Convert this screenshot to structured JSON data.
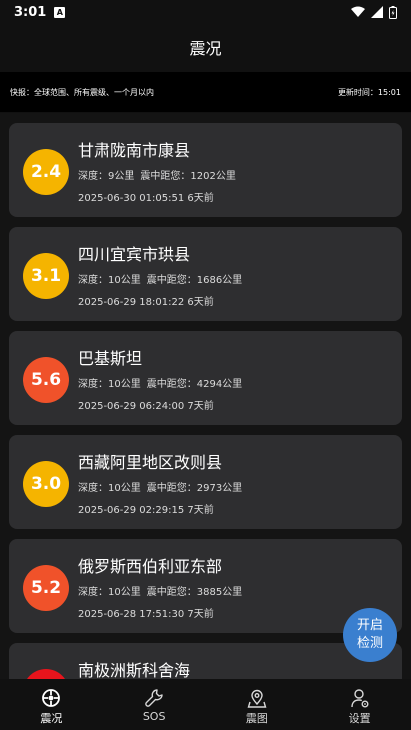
{
  "status_bar": {
    "time": "3:01",
    "notification_glyph": "A"
  },
  "header": {
    "title": "震况"
  },
  "info": {
    "left": "快报：全球范围、所有震级、一个月以内",
    "right": "更新时间：15:01"
  },
  "labels": {
    "depth_prefix": "深度：",
    "distance_prefix": "震中距您："
  },
  "earthquakes": [
    {
      "magnitude": "2.4",
      "color": "#f5b400",
      "place": "甘肃陇南市康县",
      "depth": "9公里",
      "distance": "1202公里",
      "time": "2025-06-30 01:05:51 6天前"
    },
    {
      "magnitude": "3.1",
      "color": "#f5b400",
      "place": "四川宜宾市珙县",
      "depth": "10公里",
      "distance": "1686公里",
      "time": "2025-06-29 18:01:22 6天前"
    },
    {
      "magnitude": "5.6",
      "color": "#f0522a",
      "place": "巴基斯坦",
      "depth": "10公里",
      "distance": "4294公里",
      "time": "2025-06-29 06:24:00 7天前"
    },
    {
      "magnitude": "3.0",
      "color": "#f5b400",
      "place": "西藏阿里地区改则县",
      "depth": "10公里",
      "distance": "2973公里",
      "time": "2025-06-29 02:29:15 7天前"
    },
    {
      "magnitude": "5.2",
      "color": "#f0522a",
      "place": "俄罗斯西伯利亚东部",
      "depth": "10公里",
      "distance": "3885公里",
      "time": "2025-06-28 17:51:30 7天前"
    },
    {
      "magnitude": "",
      "color": "#e8141c",
      "place": "南极洲斯科舍海",
      "depth": "",
      "distance": "",
      "time": ""
    }
  ],
  "fab": {
    "line1": "开启",
    "line2": "检测"
  },
  "tabs": [
    {
      "label": "震况",
      "icon": "crosshair-icon",
      "active": true
    },
    {
      "label": "SOS",
      "icon": "wrench-icon",
      "active": false
    },
    {
      "label": "震图",
      "icon": "map-pin-icon",
      "active": false
    },
    {
      "label": "设置",
      "icon": "user-gear-icon",
      "active": false
    }
  ]
}
